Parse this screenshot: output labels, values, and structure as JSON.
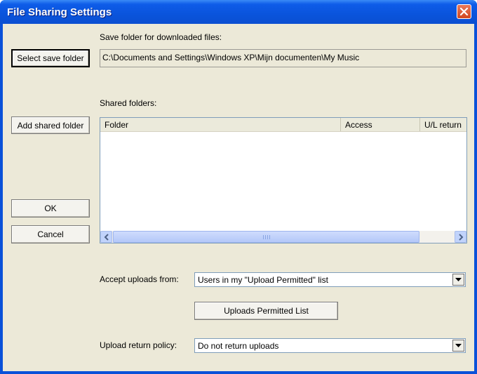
{
  "window": {
    "title": "File Sharing Settings"
  },
  "save": {
    "label": "Save folder for downloaded files:",
    "button_label": "Select save folder",
    "path": "C:\\Documents and Settings\\Windows XP\\Mijn documenten\\My Music"
  },
  "shared": {
    "label": "Shared folders:",
    "add_button_label": "Add shared folder",
    "columns": [
      "Folder",
      "Access",
      "U/L return"
    ]
  },
  "buttons": {
    "ok": "OK",
    "cancel": "Cancel"
  },
  "uploads": {
    "accept_label": "Accept uploads from:",
    "accept_value": "Users in my \"Upload Permitted\" list",
    "permitted_button": "Uploads Permitted List",
    "policy_label": "Upload return policy:",
    "policy_value": "Do not return uploads"
  },
  "colors": {
    "title_bar": "#0a54dc",
    "dialog_bg": "#ece9d8",
    "close": "#d1471f"
  },
  "icons": {
    "close": "close-icon",
    "scroll_left": "chevron-left-icon",
    "scroll_right": "chevron-right-icon",
    "dropdown": "chevron-down-icon"
  }
}
